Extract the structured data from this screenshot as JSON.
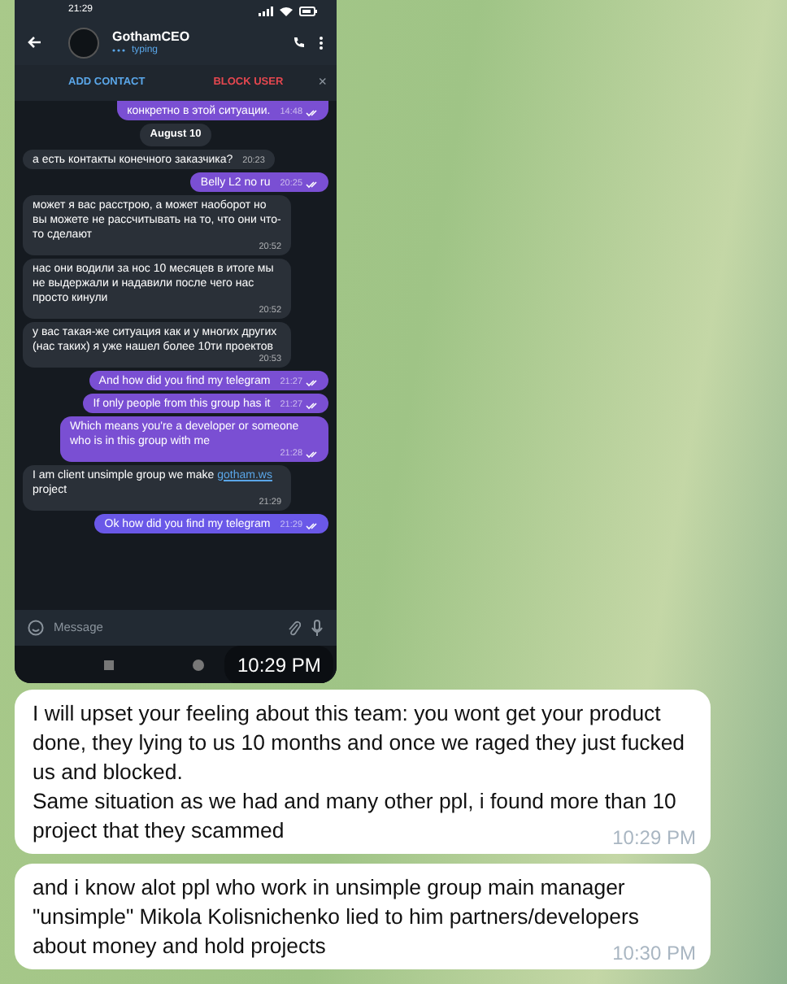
{
  "phone": {
    "status_time": "21:29",
    "contact": {
      "name": "GothamCEO",
      "status": "typing"
    },
    "actions": [
      {
        "label": "ADD CONTACT",
        "kind": "add"
      },
      {
        "label": "BLOCK USER",
        "kind": "block"
      }
    ],
    "close": "×",
    "messages": [
      {
        "kind": "out",
        "text": "конкретно в этой ситуации.",
        "time": "14:48",
        "read": true
      },
      {
        "kind": "date",
        "text": "August 10"
      },
      {
        "kind": "in",
        "text": "а есть контакты конечного заказчика?",
        "time": "20:23"
      },
      {
        "kind": "out",
        "text": "Belly L2 no ru",
        "time": "20:25",
        "read": true
      },
      {
        "kind": "in",
        "text": "может я вас расстрою, а может наоборот но вы можете не рассчитывать на то, что они что-то сделают",
        "time": "20:52"
      },
      {
        "kind": "in",
        "text": "нас они водили за нос 10 месяцев в итоге мы не выдержали и надавили после чего нас просто кинули",
        "time": "20:52"
      },
      {
        "kind": "in",
        "text": "у вас такая-же ситуация как и у многих других (нас таких) я уже нашел более 10ти проектов",
        "time": "20:53"
      },
      {
        "kind": "out",
        "text": "And how did you find my telegram",
        "time": "21:27",
        "read": true
      },
      {
        "kind": "out",
        "text": "If only people from this group has it",
        "time": "21:27",
        "read": true
      },
      {
        "kind": "out",
        "text": "Which means you're a developer or someone who is in this group with me",
        "time": "21:28",
        "read": true
      },
      {
        "kind": "in",
        "text": "I am client unsimple group we make",
        "link": "gotham.ws",
        "after": " project",
        "time": "21:29"
      },
      {
        "kind": "out",
        "text": "Ok how did you find my telegram",
        "time": "21:29",
        "read": true
      }
    ],
    "input": {
      "placeholder": "Message"
    },
    "photo_time": "10:29 PM"
  },
  "bubbles": [
    {
      "text": "I will upset your feeling about this team: you wont get your product done, they lying to us 10 months and once we raged they just fucked us and blocked.\nSame situation as we had and many other ppl, i found more than 10 project that they scammed",
      "time": "10:29 PM"
    },
    {
      "text": "and i know alot ppl who work in unsimple group main manager \"unsimple\" Mikola Kolisnichenko lied to him partners/developers about money and hold projects",
      "time": "10:30 PM"
    }
  ]
}
